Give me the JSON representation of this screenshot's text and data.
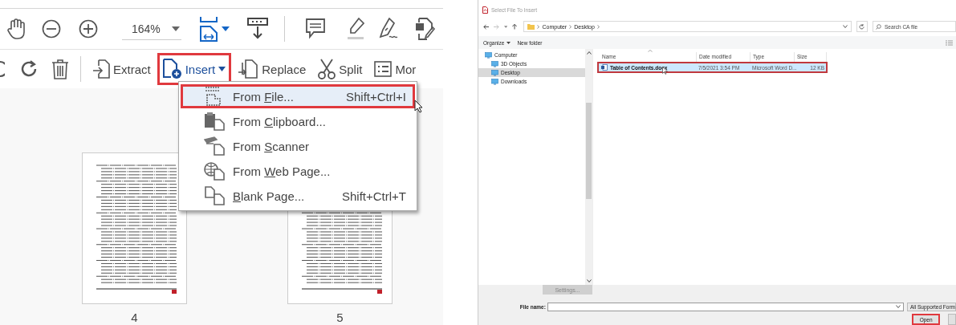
{
  "editor": {
    "zoom": "164%",
    "tools": [
      {
        "label": "Extract",
        "expanded": false,
        "annotated": false
      },
      {
        "label": "Insert",
        "expanded": true,
        "annotated": true
      },
      {
        "label": "Replace",
        "expanded": false,
        "annotated": false
      },
      {
        "label": "Split",
        "expanded": false,
        "annotated": false
      },
      {
        "label": "Mor",
        "expanded": false,
        "annotated": false
      }
    ],
    "insert_menu": [
      {
        "before": "From ",
        "key": "F",
        "after": "ile...",
        "shortcut": "Shift+Ctrl+I",
        "selected": true,
        "annotated": true
      },
      {
        "before": "From ",
        "key": "C",
        "after": "lipboard...",
        "selected": false,
        "annotated": false
      },
      {
        "before": "From ",
        "key": "S",
        "after": "canner",
        "selected": false,
        "annotated": false
      },
      {
        "before": "From ",
        "key": "W",
        "after": "eb Page...",
        "selected": false,
        "annotated": false
      },
      {
        "key": "B",
        "after": "lank Page...",
        "shortcut": "Shift+Ctrl+T",
        "selected": false,
        "annotated": false
      }
    ],
    "pages": [
      {
        "number": "4"
      },
      {
        "number": "5"
      }
    ]
  },
  "dialog": {
    "title": "Select File To Insert",
    "breadcrumbs": [
      "Computer",
      "Desktop"
    ],
    "search": {
      "placeholder": "Search CA file"
    },
    "commands": [
      "Organize",
      "New folder"
    ],
    "nav_tree": [
      {
        "label": "Computer",
        "selected": false,
        "children": [
          {
            "label": "3D Objects",
            "selected": false
          },
          {
            "label": "Desktop",
            "selected": true
          },
          {
            "label": "Downloads",
            "selected": false
          }
        ]
      }
    ],
    "columns": [
      "Name",
      "Date modified",
      "Type",
      "Size"
    ],
    "rows": [
      {
        "cells": [
          "Table of Contents.docx",
          "7/5/2021 3:54 PM",
          "Microsoft Word D...",
          "12 KB"
        ],
        "selected": true,
        "annotated": true
      }
    ],
    "settings_button": {
      "label": "Settings...",
      "disabled": true
    },
    "file_name": {
      "label": "File name:"
    },
    "filter": "All Supported Form",
    "buttons": [
      {
        "label": "Open",
        "annotated": true
      }
    ]
  }
}
